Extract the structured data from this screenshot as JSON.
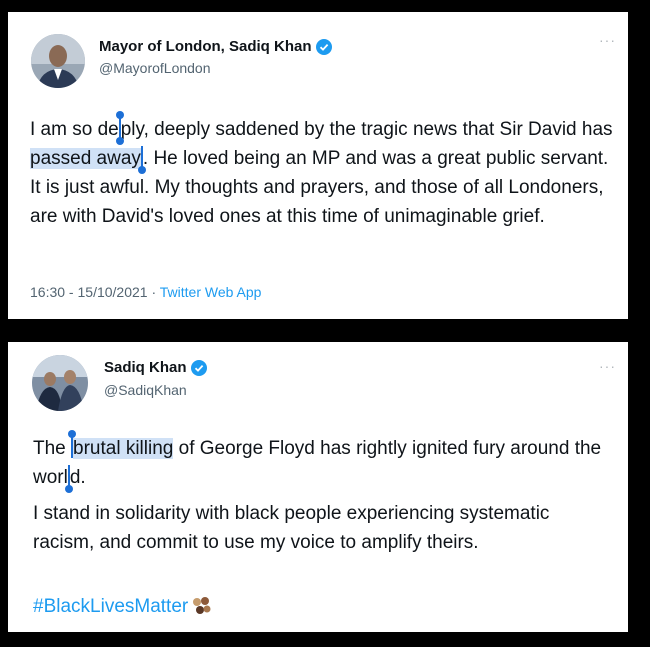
{
  "tweets": [
    {
      "author_name": "Mayor of London, Sadiq Khan",
      "handle": "@MayorofLondon",
      "more_icon": "more-dots-icon",
      "text": {
        "pre_1": "I am so de",
        "caret_word": "e",
        "pre_2": "ply, deeply saddened by the tragic news that Sir David has ",
        "highlight": "passed away",
        "post": ". He loved being an MP and was a great public servant. It is just awful. My thoughts and prayers, and those of all Londoners, are with David's loved ones at this time of unimaginable grief."
      },
      "time": "16:30",
      "date": "15/10/2021",
      "source": "Twitter Web App",
      "separator": " · "
    },
    {
      "author_name": "Sadiq Khan",
      "handle": "@SadiqKhan",
      "more_icon": "more-dots-icon",
      "text": {
        "pre": "The ",
        "highlight": "brutal killing",
        "post_1": " of George Floyd has rightly ignited fury around the worl",
        "post_2": "d.",
        "para2": "I stand in solidarity with black people experiencing systematic racism, and commit to use my voice to amplify theirs."
      },
      "hashtag": "#BlackLivesMatter",
      "emoji_icon": "raised-fist-icon"
    }
  ],
  "colors": {
    "background": "#000000",
    "card": "#ffffff",
    "text": "#0f1419",
    "secondary": "#536471",
    "link": "#1d9bf0",
    "selection": "#1d6fd6"
  }
}
